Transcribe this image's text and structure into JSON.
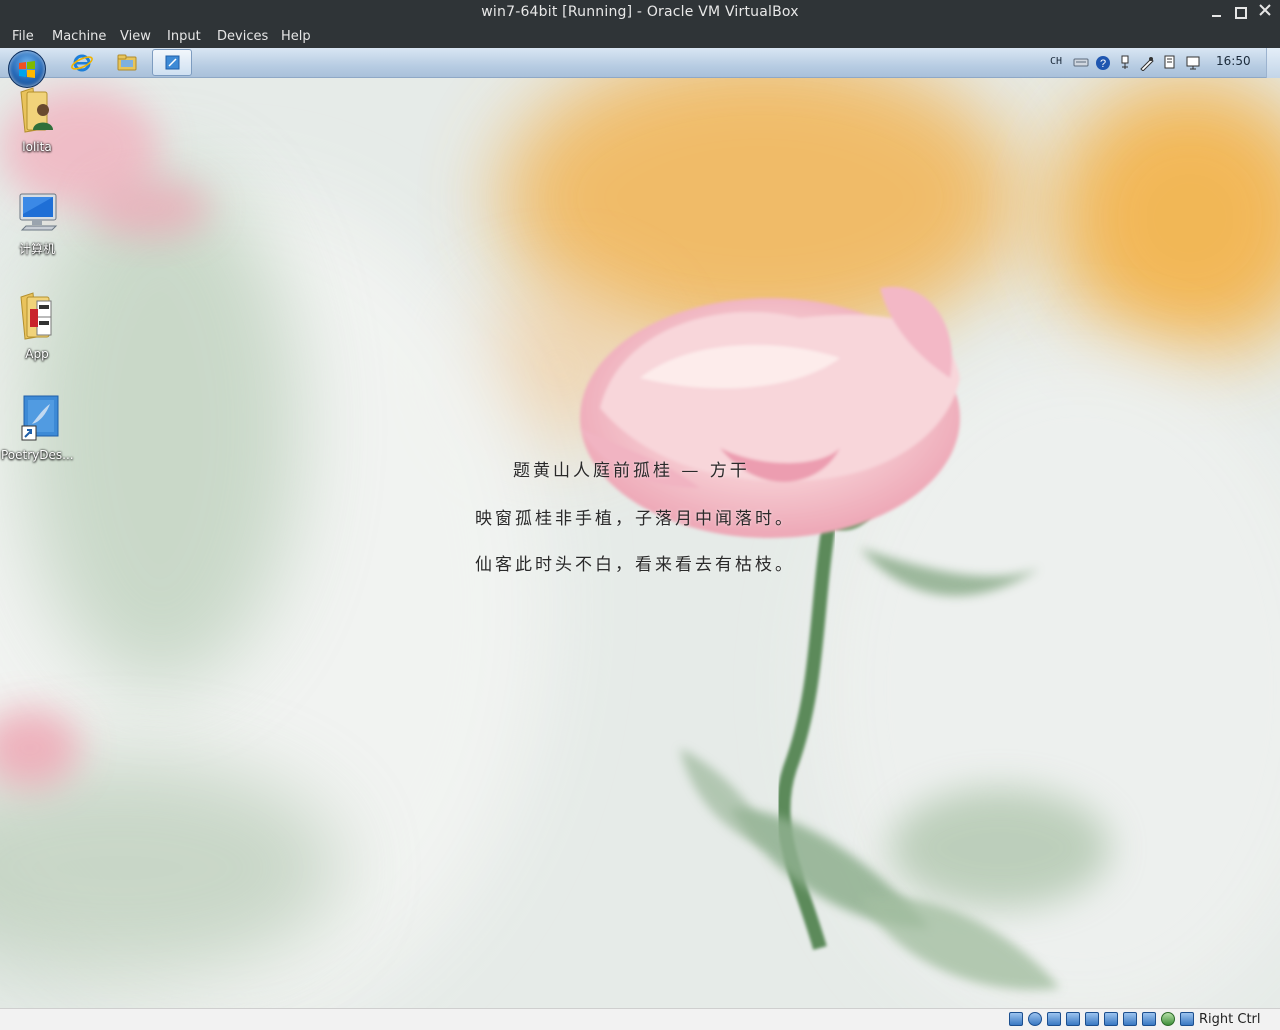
{
  "window": {
    "title": "win7-64bit [Running] - Oracle VM VirtualBox"
  },
  "menu": [
    "File",
    "Machine",
    "View",
    "Input",
    "Devices",
    "Help"
  ],
  "taskbar": {
    "language": "CH",
    "clock": "16:50",
    "pinned": [
      {
        "icon": "internet-explorer-icon"
      },
      {
        "icon": "windows-explorer-icon"
      },
      {
        "icon": "poetry-app-icon",
        "active": true
      }
    ],
    "tray_icons": [
      "keyboard-icon",
      "help-icon",
      "usb-icon",
      "pen-icon",
      "network-adapter-icon",
      "display-icon"
    ]
  },
  "desktop": {
    "icons": [
      {
        "label": "lolita",
        "icon": "user-folder-icon"
      },
      {
        "label": "计算机",
        "icon": "computer-icon"
      },
      {
        "label": "App",
        "icon": "app-folder-icon"
      },
      {
        "label": "PoetryDes...",
        "icon": "poetry-shortcut-icon"
      }
    ]
  },
  "poem": {
    "title": "题黄山人庭前孤桂 — 方干",
    "line1": "映窗孤桂非手植，子落月中闻落时。",
    "line2": "仙客此时头不白，看来看去有枯枝。"
  },
  "statusbar": {
    "host_key": "Right Ctrl",
    "icons": [
      "hard-disk-icon",
      "optical-drive-icon",
      "audio-icon",
      "network-icon",
      "usb-status-icon",
      "shared-folders-icon",
      "display-status-icon",
      "video-capture-icon",
      "cpu-icon",
      "mouse-integration-icon",
      "host-key-indicator-icon"
    ]
  },
  "colors": {
    "chrome": "#2f3437",
    "taskbar": "#c3d6ea",
    "poem_text": "#2a2a2a",
    "petal": "#f4c7d0",
    "bokeh_orange": "#f2b24a"
  }
}
